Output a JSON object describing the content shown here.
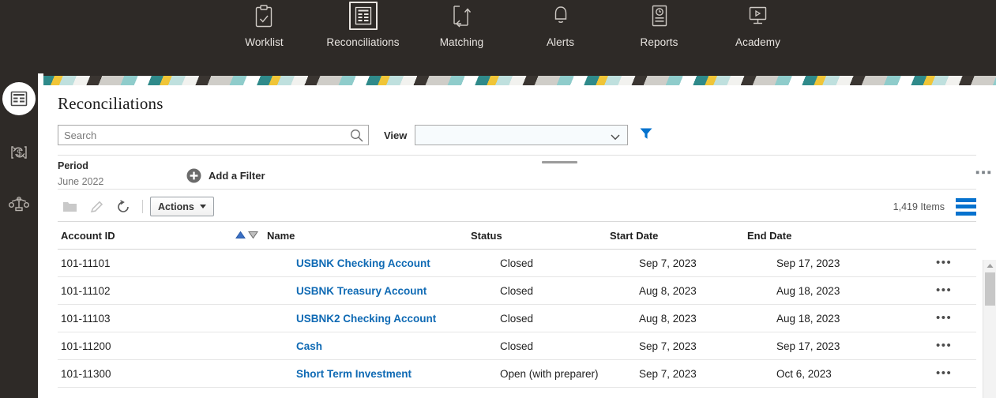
{
  "topnav": {
    "items": [
      {
        "label": "Worklist",
        "icon": "clipboard-check-icon",
        "active": false
      },
      {
        "label": "Reconciliations",
        "icon": "list-document-icon",
        "active": true
      },
      {
        "label": "Matching",
        "icon": "arrow-exchange-icon",
        "active": false
      },
      {
        "label": "Alerts",
        "icon": "bell-icon",
        "active": false
      },
      {
        "label": "Reports",
        "icon": "report-clock-icon",
        "active": false
      },
      {
        "label": "Academy",
        "icon": "monitor-play-icon",
        "active": false
      }
    ]
  },
  "rail": {
    "items": [
      {
        "name": "reconciliations-rail-icon",
        "selected": true
      },
      {
        "name": "transaction-matching-rail-icon",
        "selected": false
      },
      {
        "name": "balance-scale-rail-icon",
        "selected": false
      }
    ]
  },
  "page": {
    "title": "Reconciliations"
  },
  "search": {
    "placeholder": "Search",
    "value": ""
  },
  "view": {
    "label": "View",
    "selected": ""
  },
  "filterbar": {
    "period_label": "Period",
    "period_value": "June 2022",
    "add_filter_label": "Add a Filter",
    "overflow": "▪▪▪"
  },
  "toolbar": {
    "actions_label": "Actions",
    "items_count": "1,419 Items"
  },
  "table": {
    "columns": [
      "Account ID",
      "Name",
      "Status",
      "Start Date",
      "End Date"
    ],
    "sort": {
      "column": "Account ID",
      "direction": "asc"
    },
    "rows": [
      {
        "account_id": "101-11101",
        "name": "USBNK Checking Account",
        "status": "Closed",
        "start_date": "Sep 7, 2023",
        "end_date": "Sep 17, 2023"
      },
      {
        "account_id": "101-11102",
        "name": "USBNK Treasury Account",
        "status": "Closed",
        "start_date": "Aug 8, 2023",
        "end_date": "Aug 18, 2023"
      },
      {
        "account_id": "101-11103",
        "name": "USBNK2 Checking Account",
        "status": "Closed",
        "start_date": "Aug 8, 2023",
        "end_date": "Aug 18, 2023"
      },
      {
        "account_id": "101-11200",
        "name": "Cash",
        "status": "Closed",
        "start_date": "Sep 7, 2023",
        "end_date": "Sep 17, 2023"
      },
      {
        "account_id": "101-11300",
        "name": "Short Term Investment",
        "status": "Open (with preparer)",
        "start_date": "Sep 7, 2023",
        "end_date": "Oct 6, 2023"
      }
    ],
    "row_menu": "•••"
  },
  "colors": {
    "chrome": "#2e2a27",
    "link": "#0f6ab4",
    "accent": "#0572ce",
    "sort_active": "#3a6fc4"
  }
}
